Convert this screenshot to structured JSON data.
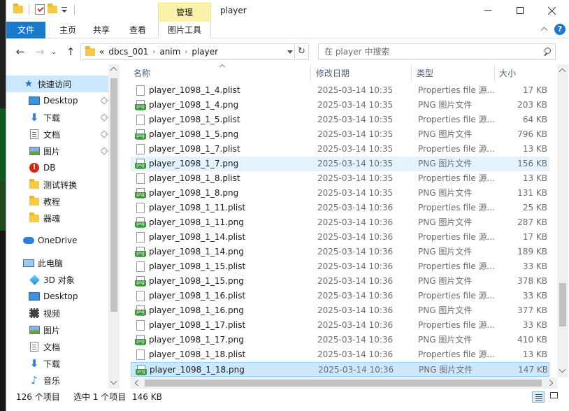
{
  "window": {
    "title": "player",
    "contextual_tab": "管理"
  },
  "ribbon": {
    "tabs": [
      "文件",
      "主页",
      "共享",
      "查看",
      "图片工具"
    ]
  },
  "address": {
    "crumb_prefix": "«",
    "crumbs": [
      "dbcs_001",
      "anim",
      "player"
    ],
    "search_placeholder": "在 player 中搜索"
  },
  "nav": {
    "quick_access": "快速访问",
    "items": [
      {
        "label": "Desktop",
        "icon": "desktop-icon",
        "pinned": true
      },
      {
        "label": "下载",
        "icon": "download-icon",
        "pinned": true
      },
      {
        "label": "文档",
        "icon": "document-icon",
        "pinned": true
      },
      {
        "label": "图片",
        "icon": "picture-icon",
        "pinned": true
      },
      {
        "label": "DB",
        "icon": "db-icon",
        "pinned": false
      },
      {
        "label": "测试转换",
        "icon": "folder-icon",
        "pinned": false
      },
      {
        "label": "教程",
        "icon": "folder-icon",
        "pinned": false
      },
      {
        "label": "器魂",
        "icon": "folder-icon",
        "pinned": false
      }
    ],
    "onedrive": "OneDrive",
    "this_pc": "此电脑",
    "pc_items": [
      {
        "label": "3D 对象",
        "icon": "3d-objects-icon"
      },
      {
        "label": "Desktop",
        "icon": "desktop-icon"
      },
      {
        "label": "视频",
        "icon": "video-icon"
      },
      {
        "label": "图片",
        "icon": "picture-icon"
      },
      {
        "label": "文档",
        "icon": "document-icon"
      },
      {
        "label": "下载",
        "icon": "download-icon"
      },
      {
        "label": "音乐",
        "icon": "music-icon"
      }
    ]
  },
  "columns": {
    "name": "名称",
    "date": "修改日期",
    "type": "类型",
    "size": "大小"
  },
  "files": [
    {
      "name": "player_1098_1_4.plist",
      "date": "2025-03-14 10:35",
      "type": "Properties file 源...",
      "size": "17 KB",
      "kind": "plist"
    },
    {
      "name": "player_1098_1_4.png",
      "date": "2025-03-14 10:35",
      "type": "PNG 图片文件",
      "size": "203 KB",
      "kind": "png"
    },
    {
      "name": "player_1098_1_5.plist",
      "date": "2025-03-14 10:35",
      "type": "Properties file 源...",
      "size": "64 KB",
      "kind": "plist"
    },
    {
      "name": "player_1098_1_5.png",
      "date": "2025-03-14 10:35",
      "type": "PNG 图片文件",
      "size": "796 KB",
      "kind": "png"
    },
    {
      "name": "player_1098_1_7.plist",
      "date": "2025-03-14 10:35",
      "type": "Properties file 源...",
      "size": "13 KB",
      "kind": "plist"
    },
    {
      "name": "player_1098_1_7.png",
      "date": "2025-03-14 10:35",
      "type": "PNG 图片文件",
      "size": "156 KB",
      "kind": "png",
      "state": "hover"
    },
    {
      "name": "player_1098_1_8.plist",
      "date": "2025-03-14 10:35",
      "type": "Properties file 源...",
      "size": "13 KB",
      "kind": "plist"
    },
    {
      "name": "player_1098_1_8.png",
      "date": "2025-03-14 10:35",
      "type": "PNG 图片文件",
      "size": "131 KB",
      "kind": "png"
    },
    {
      "name": "player_1098_1_11.plist",
      "date": "2025-03-14 10:36",
      "type": "Properties file 源...",
      "size": "25 KB",
      "kind": "plist"
    },
    {
      "name": "player_1098_1_11.png",
      "date": "2025-03-14 10:36",
      "type": "PNG 图片文件",
      "size": "287 KB",
      "kind": "png"
    },
    {
      "name": "player_1098_1_14.plist",
      "date": "2025-03-14 10:36",
      "type": "Properties file 源...",
      "size": "17 KB",
      "kind": "plist"
    },
    {
      "name": "player_1098_1_14.png",
      "date": "2025-03-14 10:36",
      "type": "PNG 图片文件",
      "size": "189 KB",
      "kind": "png"
    },
    {
      "name": "player_1098_1_15.plist",
      "date": "2025-03-14 10:36",
      "type": "Properties file 源...",
      "size": "33 KB",
      "kind": "plist"
    },
    {
      "name": "player_1098_1_15.png",
      "date": "2025-03-14 10:36",
      "type": "PNG 图片文件",
      "size": "378 KB",
      "kind": "png"
    },
    {
      "name": "player_1098_1_16.plist",
      "date": "2025-03-14 10:36",
      "type": "Properties file 源...",
      "size": "33 KB",
      "kind": "plist"
    },
    {
      "name": "player_1098_1_16.png",
      "date": "2025-03-14 10:36",
      "type": "PNG 图片文件",
      "size": "377 KB",
      "kind": "png"
    },
    {
      "name": "player_1098_1_17.plist",
      "date": "2025-03-14 10:36",
      "type": "Properties file 源...",
      "size": "33 KB",
      "kind": "plist"
    },
    {
      "name": "player_1098_1_17.png",
      "date": "2025-03-14 10:36",
      "type": "PNG 图片文件",
      "size": "410 KB",
      "kind": "png"
    },
    {
      "name": "player_1098_1_18.plist",
      "date": "2025-03-14 10:36",
      "type": "Properties file 源...",
      "size": "13 KB",
      "kind": "plist"
    },
    {
      "name": "player_1098_1_18.png",
      "date": "2025-03-14 10:36",
      "type": "PNG 图片文件",
      "size": "147 KB",
      "kind": "png",
      "state": "selected"
    }
  ],
  "status": {
    "item_count": "126 个项目",
    "selection": "选中 1 个项目",
    "selection_size": "146 KB"
  },
  "colors": {
    "accent": "#1979ca",
    "selected_row": "#cce8ff",
    "hover_row": "#e5f3ff",
    "contextual_tab": "#fbf3a8"
  }
}
